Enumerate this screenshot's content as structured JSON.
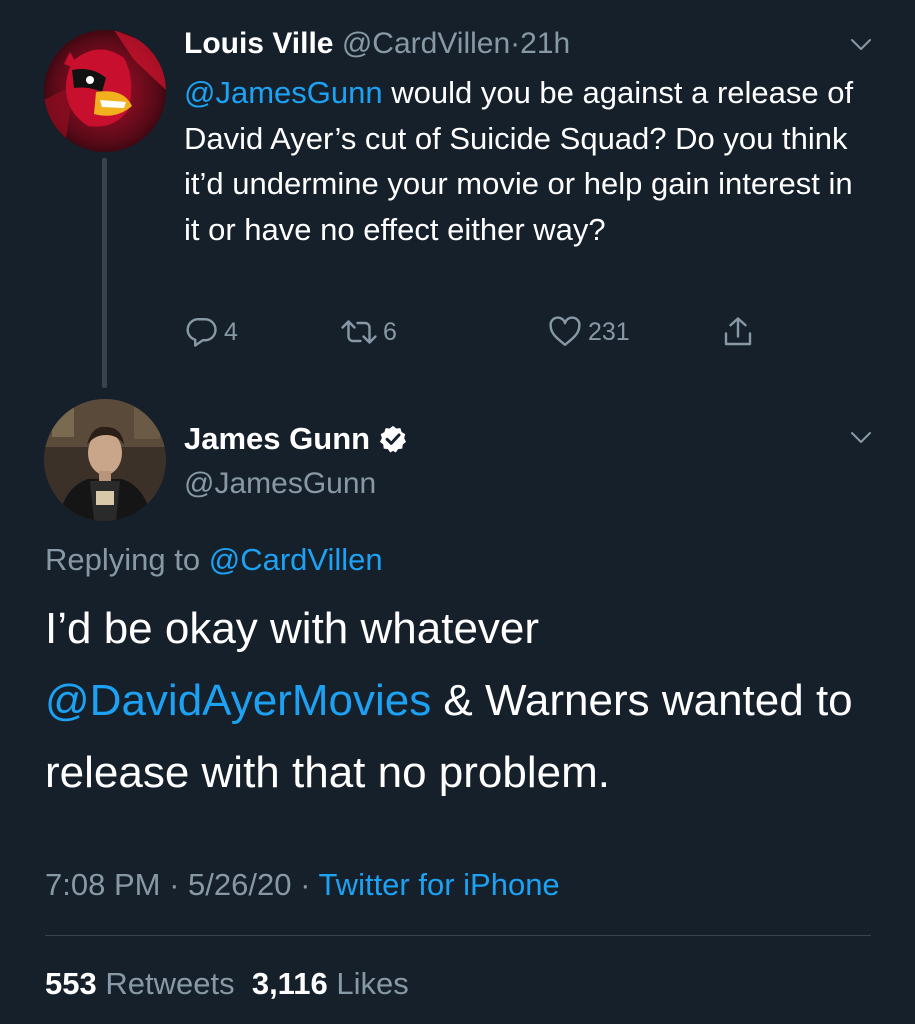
{
  "parent_tweet": {
    "display_name": "Louis Ville",
    "handle": "@CardVillen",
    "separator": "·",
    "time_ago": "21h",
    "mention": "@JamesGunn",
    "text_rest": " would you be against a release of David Ayer’s cut of Suicide Squad? Do you think it’d undermine your movie or help gain interest in it or have no effect either way?",
    "replies": "4",
    "retweets": "6",
    "likes": "231"
  },
  "main_tweet": {
    "display_name": "James Gunn",
    "handle": "@JamesGunn",
    "replying_prefix": "Replying to ",
    "replying_handle": "@CardVillen",
    "text_part1": "I’d be okay with whatever ",
    "text_mention": "@DavidAyerMovies",
    "text_part2": " & Warners wanted to release with that no problem.",
    "time": "7:08 PM",
    "date": "5/26/20",
    "separator": " · ",
    "source": "Twitter for iPhone",
    "retweet_count": "553",
    "retweet_label": "Retweets",
    "like_count": "3,116",
    "like_label": "Likes"
  },
  "colors": {
    "background": "#15202b",
    "text": "#ffffff",
    "muted": "#8899a6",
    "link": "#1da1f2",
    "divider": "#38444d"
  },
  "icons": [
    "chevron-down-icon",
    "reply-icon",
    "retweet-icon",
    "like-icon",
    "share-icon",
    "verified-badge-icon"
  ]
}
